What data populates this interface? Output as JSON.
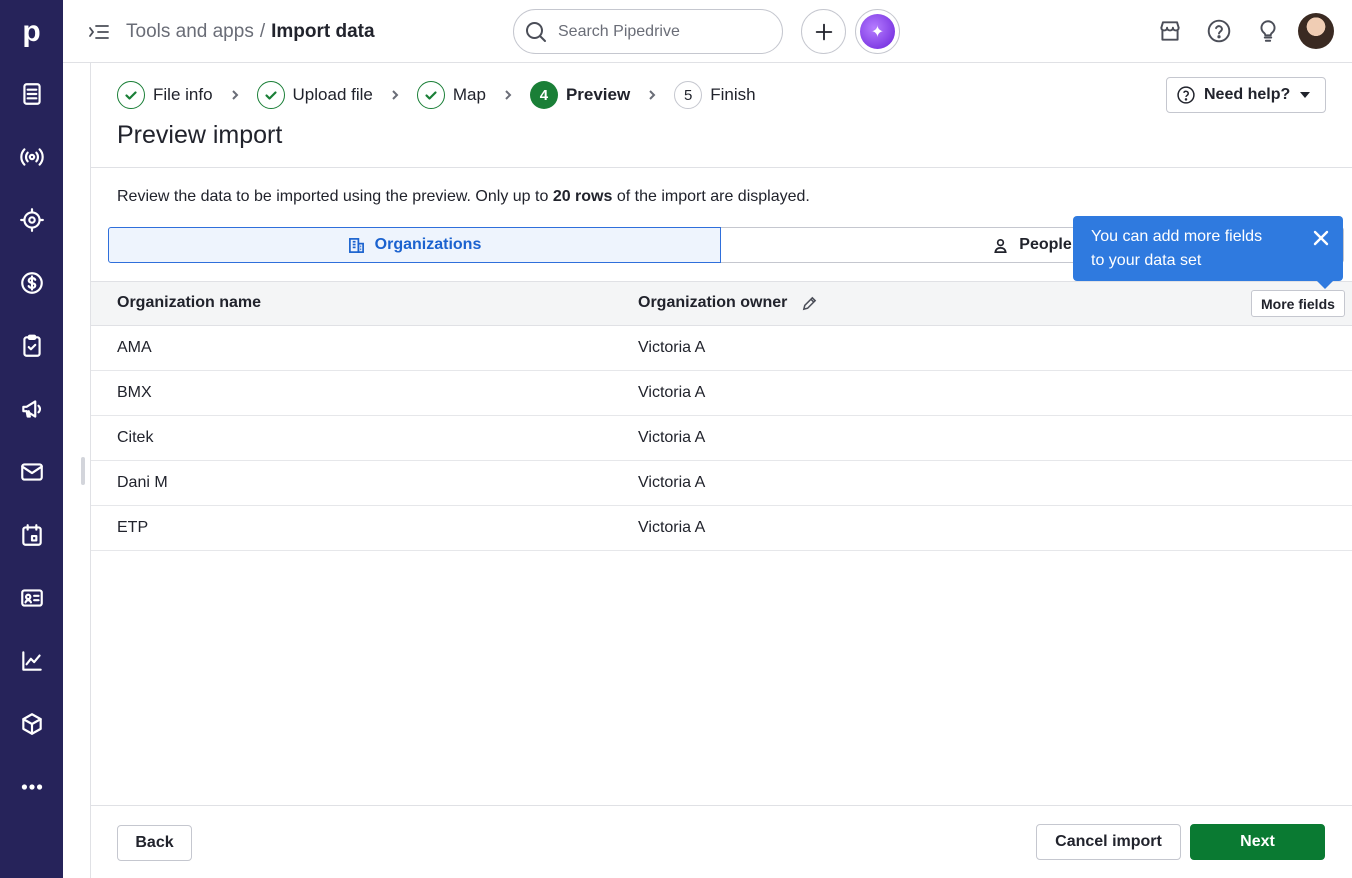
{
  "app": {
    "logo": "p",
    "colors": {
      "rail": "#26235a",
      "accent": "#1b62cf",
      "success": "#1a7f37",
      "primary_button": "#0a7a32",
      "tooltip": "#2f7adf"
    }
  },
  "sidebar": {
    "items": [
      {
        "icon": "leads-inbox-icon"
      },
      {
        "icon": "broadcast-icon"
      },
      {
        "icon": "target-icon"
      },
      {
        "icon": "deals-dollar-icon"
      },
      {
        "icon": "activities-clipboard-icon"
      },
      {
        "icon": "campaigns-megaphone-icon"
      },
      {
        "icon": "mail-icon"
      },
      {
        "icon": "calendar-icon"
      },
      {
        "icon": "contacts-card-icon"
      },
      {
        "icon": "insights-chart-icon"
      },
      {
        "icon": "products-box-icon"
      },
      {
        "icon": "more-dots-icon"
      }
    ]
  },
  "header": {
    "breadcrumb": {
      "parent": "Tools and apps",
      "separator": "/",
      "current": "Import data"
    },
    "search": {
      "placeholder": "Search Pipedrive",
      "value": ""
    }
  },
  "steps": [
    {
      "label": "File info",
      "state": "done"
    },
    {
      "label": "Upload file",
      "state": "done"
    },
    {
      "label": "Map",
      "state": "done"
    },
    {
      "number": "4",
      "label": "Preview",
      "state": "active"
    },
    {
      "number": "5",
      "label": "Finish",
      "state": "pending"
    }
  ],
  "help_button": {
    "label": "Need help?"
  },
  "page": {
    "title": "Preview import",
    "description_pre": "Review the data to be imported using the preview. Only up to ",
    "description_bold": "20 rows",
    "description_post": " of the import are displayed."
  },
  "tabs": [
    {
      "label": "Organizations",
      "selected": true
    },
    {
      "label": "People",
      "selected": false
    }
  ],
  "table": {
    "columns": [
      "Organization name",
      "Organization owner"
    ],
    "more_fields_label": "More fields",
    "rows": [
      [
        "AMA",
        "Victoria A"
      ],
      [
        "BMX",
        "Victoria A"
      ],
      [
        "Citek",
        "Victoria A"
      ],
      [
        "Dani M",
        "Victoria A"
      ],
      [
        "ETP",
        "Victoria A"
      ]
    ]
  },
  "tooltip": {
    "line1": "You can add more fields",
    "line2": "to your data set"
  },
  "footer": {
    "back_label": "Back",
    "cancel_label": "Cancel import",
    "next_label": "Next"
  }
}
